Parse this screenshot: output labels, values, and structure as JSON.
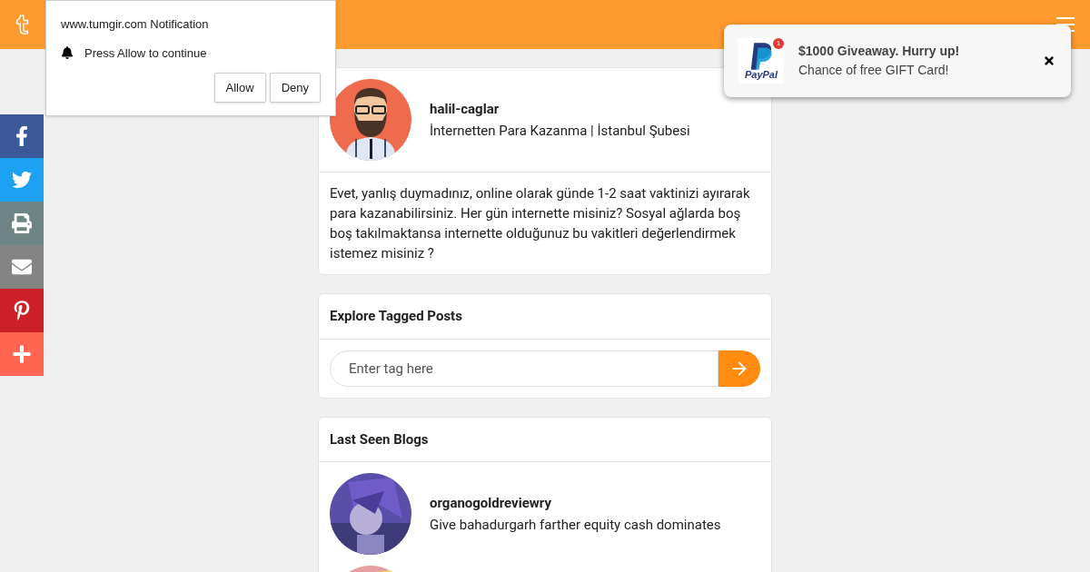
{
  "share_bar": [
    {
      "kind": "facebook",
      "color": "#3b5998"
    },
    {
      "kind": "twitter",
      "color": "#1da1f2"
    },
    {
      "kind": "print",
      "color": "#6d8585"
    },
    {
      "kind": "email",
      "color": "#848484"
    },
    {
      "kind": "pinterest",
      "color": "#cb2027"
    },
    {
      "kind": "more",
      "color": "#ff6550"
    }
  ],
  "profile": {
    "name": "halil-caglar",
    "tagline": "İnternetten Para Kazanma | İstanbul Şubesi",
    "bio": "Evet, yanlış duymadınız, online olarak günde 1-2 saat vaktinizi ayırarak para kazanabilirsiniz. Her gün internette misiniz? Sosyal ağlarda boş boş takılmaktansa internette olduğunuz bu vakitleri değerlendirmek istemez misiniz ?"
  },
  "tag_search": {
    "title": "Explore Tagged Posts",
    "placeholder": "Enter tag here"
  },
  "last_seen": {
    "title": "Last Seen Blogs",
    "blogs": [
      {
        "name": "organogoldreviewry",
        "description": "Give bahadurgarh farther equity cash dominates"
      },
      {
        "kind": "picture"
      }
    ]
  },
  "notification_prompt": {
    "title": "www.tumgir.com Notification",
    "message": "Press Allow to continue",
    "buttons": [
      "Allow",
      "Deny"
    ]
  },
  "toast": {
    "brand": "PayPal",
    "badge": "1",
    "title": "$1000 Giveaway. Hurry up!",
    "message": "Chance of free GIFT Card!"
  }
}
